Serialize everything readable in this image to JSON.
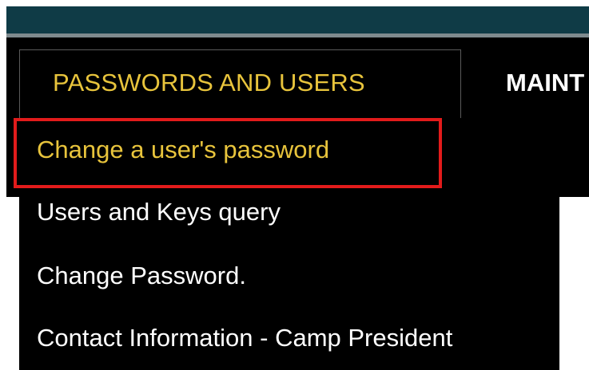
{
  "nav": {
    "active_tab": "PASSWORDS AND USERS",
    "next_tab": "MAINT"
  },
  "dropdown": {
    "items": [
      {
        "label": "Change a user's password",
        "selected": true
      },
      {
        "label": "Users and Keys query"
      },
      {
        "label": "Change Password."
      },
      {
        "label": "Contact Information - Camp President"
      }
    ]
  },
  "colors": {
    "top_bar": "#0f3b46",
    "menu_background": "#000000",
    "accent_text": "#e8c43c",
    "highlight": "#e21b1b"
  }
}
